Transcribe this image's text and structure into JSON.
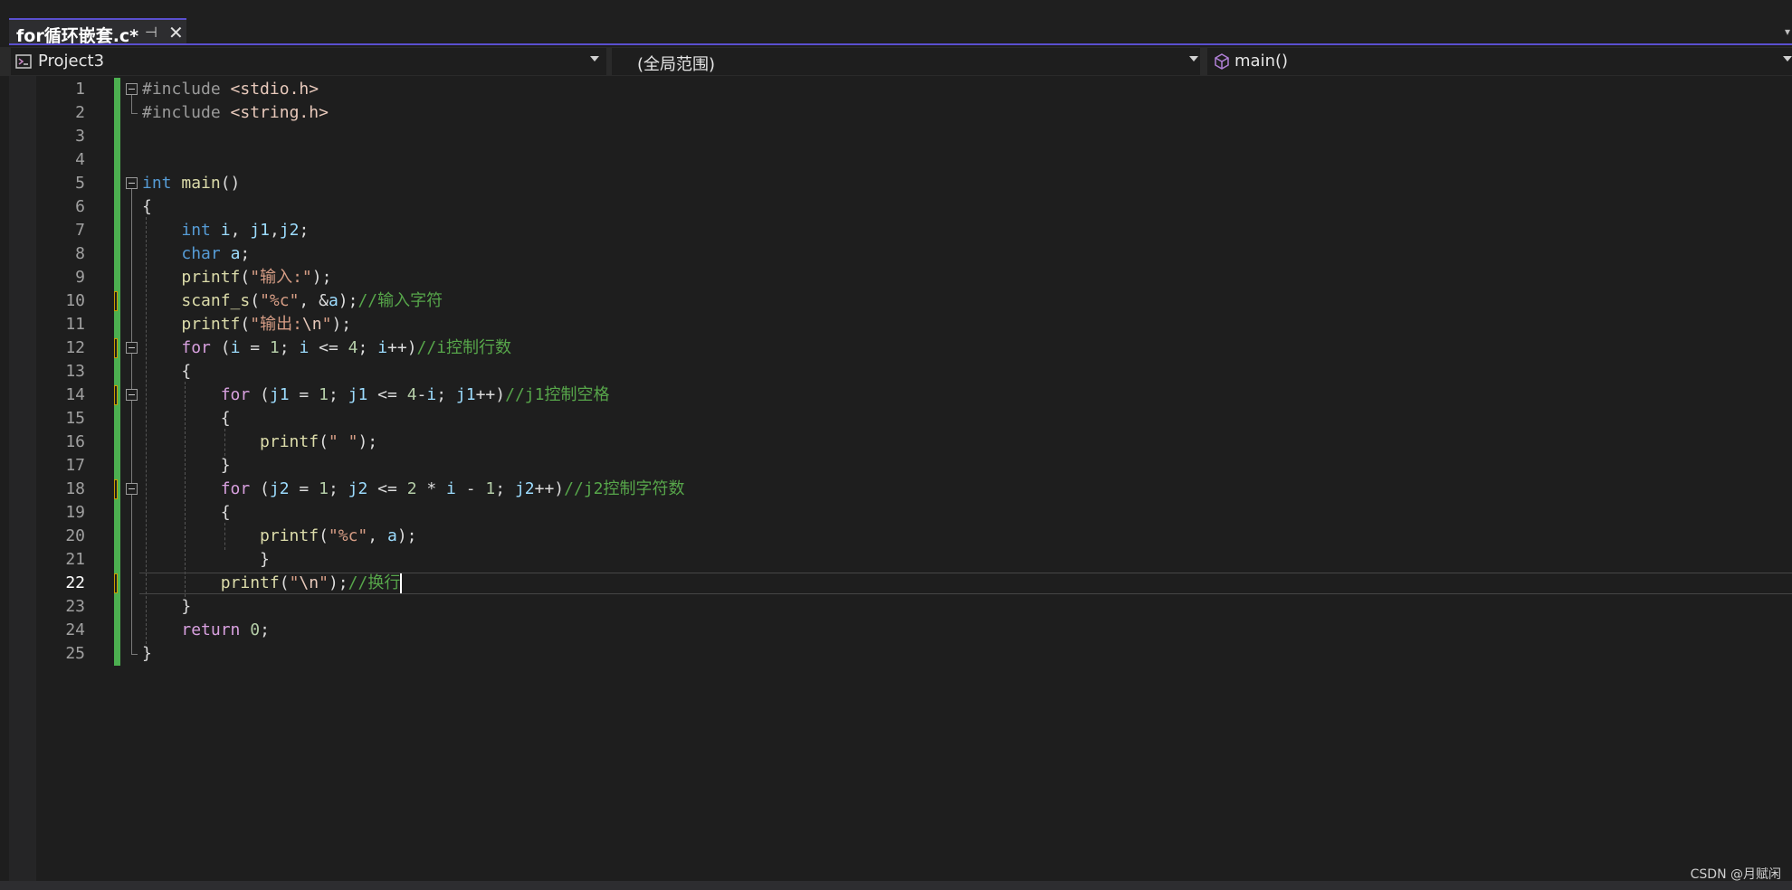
{
  "tab": {
    "title": "for循环嵌套.c*",
    "pin_glyph": "⊣",
    "close_glyph": "✕"
  },
  "navbar": {
    "project": "Project3",
    "scope": "(全局范围)",
    "member": "main()"
  },
  "editor": {
    "current_line": 22,
    "lines": [
      [
        [
          "pre",
          "#include "
        ],
        [
          "inc",
          "<stdio.h>"
        ]
      ],
      [
        [
          "pre",
          "#include "
        ],
        [
          "inc",
          "<string.h>"
        ]
      ],
      [],
      [],
      [
        [
          "kw",
          "int"
        ],
        [
          "txt",
          " "
        ],
        [
          "fn",
          "main"
        ],
        [
          "txt",
          "()"
        ]
      ],
      [
        [
          "txt",
          "{"
        ]
      ],
      [
        [
          "txt",
          "    "
        ],
        [
          "kw",
          "int"
        ],
        [
          "txt",
          " "
        ],
        [
          "var",
          "i"
        ],
        [
          "txt",
          ", "
        ],
        [
          "var",
          "j1"
        ],
        [
          "txt",
          ","
        ],
        [
          "var",
          "j2"
        ],
        [
          "txt",
          ";"
        ]
      ],
      [
        [
          "txt",
          "    "
        ],
        [
          "kw",
          "char"
        ],
        [
          "txt",
          " "
        ],
        [
          "var",
          "a"
        ],
        [
          "txt",
          ";"
        ]
      ],
      [
        [
          "txt",
          "    "
        ],
        [
          "fn",
          "printf"
        ],
        [
          "txt",
          "("
        ],
        [
          "str",
          "\"输入:\""
        ],
        [
          "txt",
          ");"
        ]
      ],
      [
        [
          "txt",
          "    "
        ],
        [
          "fn",
          "scanf_s"
        ],
        [
          "txt",
          "("
        ],
        [
          "str",
          "\"%c\""
        ],
        [
          "txt",
          ", &"
        ],
        [
          "var",
          "a"
        ],
        [
          "txt",
          ");"
        ],
        [
          "com",
          "//输入字符"
        ]
      ],
      [
        [
          "txt",
          "    "
        ],
        [
          "fn",
          "printf"
        ],
        [
          "txt",
          "("
        ],
        [
          "str",
          "\"输出:"
        ],
        [
          "esc",
          "\\n"
        ],
        [
          "str",
          "\""
        ],
        [
          "txt",
          ");"
        ]
      ],
      [
        [
          "txt",
          "    "
        ],
        [
          "ctl",
          "for"
        ],
        [
          "txt",
          " ("
        ],
        [
          "var",
          "i"
        ],
        [
          "txt",
          " = "
        ],
        [
          "num",
          "1"
        ],
        [
          "txt",
          "; "
        ],
        [
          "var",
          "i"
        ],
        [
          "txt",
          " <= "
        ],
        [
          "num",
          "4"
        ],
        [
          "txt",
          "; "
        ],
        [
          "var",
          "i"
        ],
        [
          "txt",
          "++)"
        ],
        [
          "com",
          "//i控制行数"
        ]
      ],
      [
        [
          "txt",
          "    {"
        ]
      ],
      [
        [
          "txt",
          "        "
        ],
        [
          "ctl",
          "for"
        ],
        [
          "txt",
          " ("
        ],
        [
          "var",
          "j1"
        ],
        [
          "txt",
          " = "
        ],
        [
          "num",
          "1"
        ],
        [
          "txt",
          "; "
        ],
        [
          "var",
          "j1"
        ],
        [
          "txt",
          " <= "
        ],
        [
          "num",
          "4"
        ],
        [
          "txt",
          "-"
        ],
        [
          "var",
          "i"
        ],
        [
          "txt",
          "; "
        ],
        [
          "var",
          "j1"
        ],
        [
          "txt",
          "++)"
        ],
        [
          "com",
          "//j1控制空格"
        ]
      ],
      [
        [
          "txt",
          "        {"
        ]
      ],
      [
        [
          "txt",
          "            "
        ],
        [
          "fn",
          "printf"
        ],
        [
          "txt",
          "("
        ],
        [
          "str",
          "\" \""
        ],
        [
          "txt",
          ");"
        ]
      ],
      [
        [
          "txt",
          "        }"
        ]
      ],
      [
        [
          "txt",
          "        "
        ],
        [
          "ctl",
          "for"
        ],
        [
          "txt",
          " ("
        ],
        [
          "var",
          "j2"
        ],
        [
          "txt",
          " = "
        ],
        [
          "num",
          "1"
        ],
        [
          "txt",
          "; "
        ],
        [
          "var",
          "j2"
        ],
        [
          "txt",
          " <= "
        ],
        [
          "num",
          "2"
        ],
        [
          "txt",
          " * "
        ],
        [
          "var",
          "i"
        ],
        [
          "txt",
          " - "
        ],
        [
          "num",
          "1"
        ],
        [
          "txt",
          "; "
        ],
        [
          "var",
          "j2"
        ],
        [
          "txt",
          "++)"
        ],
        [
          "com",
          "//j2控制字符数"
        ]
      ],
      [
        [
          "txt",
          "        {"
        ]
      ],
      [
        [
          "txt",
          "            "
        ],
        [
          "fn",
          "printf"
        ],
        [
          "txt",
          "("
        ],
        [
          "str",
          "\"%c\""
        ],
        [
          "txt",
          ", "
        ],
        [
          "var",
          "a"
        ],
        [
          "txt",
          ");"
        ]
      ],
      [
        [
          "txt",
          "            }"
        ]
      ],
      [
        [
          "txt",
          "        "
        ],
        [
          "fn",
          "printf"
        ],
        [
          "txt",
          "("
        ],
        [
          "str",
          "\""
        ],
        [
          "esc",
          "\\n"
        ],
        [
          "str",
          "\""
        ],
        [
          "txt",
          ");"
        ],
        [
          "com",
          "//换行"
        ]
      ],
      [
        [
          "txt",
          "    }"
        ]
      ],
      [
        [
          "txt",
          "    "
        ],
        [
          "ctl",
          "return"
        ],
        [
          "txt",
          " "
        ],
        [
          "num",
          "0"
        ],
        [
          "txt",
          ";"
        ]
      ],
      [
        [
          "txt",
          "}"
        ]
      ]
    ],
    "modified_lines": [
      10,
      12,
      14,
      18,
      22
    ],
    "fold_lines": [
      1,
      5,
      12,
      14,
      18
    ]
  },
  "watermark": "CSDN @月赋闲",
  "colors": {
    "background": "#1e1e1e",
    "accent": "#5a4fcf",
    "change_bar": "#4caf50",
    "keyword": "#569cd6",
    "control": "#d8a0df",
    "string": "#d69d85",
    "function": "#dcdcaa",
    "variable": "#9cdcfe",
    "number": "#b5cea8",
    "comment": "#57a64a"
  }
}
